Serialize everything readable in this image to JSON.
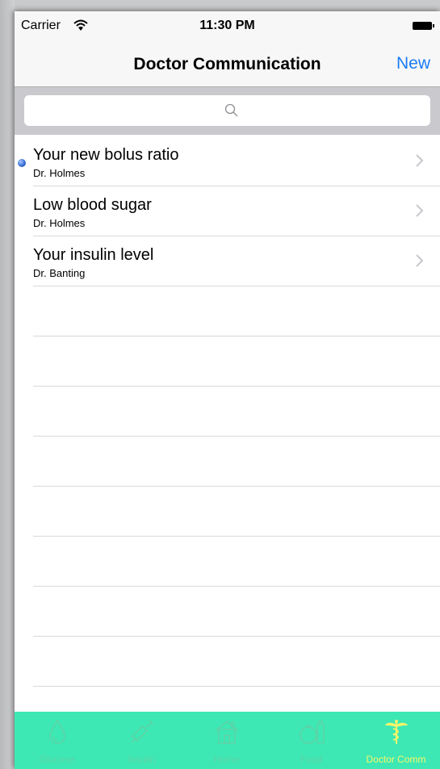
{
  "status_bar": {
    "carrier": "Carrier",
    "time": "11:30 PM"
  },
  "nav": {
    "title": "Doctor Communication",
    "new_label": "New"
  },
  "search": {
    "placeholder": ""
  },
  "messages": [
    {
      "title": "Your new bolus ratio",
      "sender": "Dr. Holmes",
      "unread": true
    },
    {
      "title": "Low blood sugar",
      "sender": "Dr. Holmes",
      "unread": false
    },
    {
      "title": "Your insulin level",
      "sender": "Dr. Banting",
      "unread": false
    }
  ],
  "tabs": [
    {
      "label": "Glucose",
      "icon": "drop-icon",
      "active": false
    },
    {
      "label": "Insulin",
      "icon": "syringe-icon",
      "active": false
    },
    {
      "label": "Home",
      "icon": "home-icon",
      "active": false
    },
    {
      "label": "Food",
      "icon": "food-icon",
      "active": false
    },
    {
      "label": "Doctor Comm",
      "icon": "caduceus-icon",
      "active": true
    }
  ],
  "colors": {
    "accent": "#1a7cf6",
    "tab_bar": "#3de8b4",
    "tab_inactive": "#5fd2a6",
    "tab_active": "#f5f56a"
  }
}
